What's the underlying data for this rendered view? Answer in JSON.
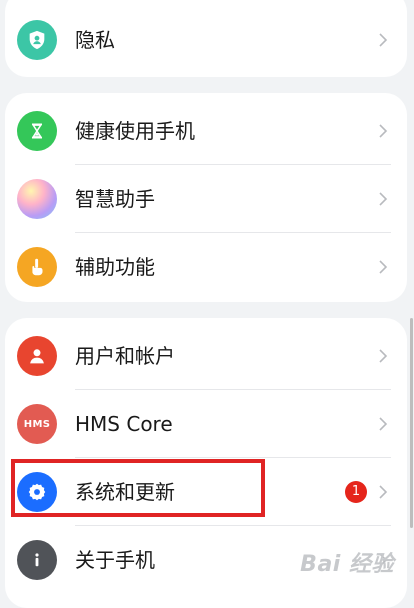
{
  "cards": [
    {
      "items": [
        {
          "label": "隐私",
          "icon": "privacy-shield-icon"
        }
      ]
    },
    {
      "items": [
        {
          "label": "健康使用手机",
          "icon": "hourglass-icon"
        },
        {
          "label": "智慧助手",
          "icon": "assistant-orb-icon"
        },
        {
          "label": "辅助功能",
          "icon": "hand-pointer-icon"
        }
      ]
    },
    {
      "items": [
        {
          "label": "用户和帐户",
          "icon": "user-icon"
        },
        {
          "label": "HMS Core",
          "icon": "hms-icon",
          "icon_text": "HMS"
        },
        {
          "label": "系统和更新",
          "icon": "gear-icon",
          "badge": "1"
        },
        {
          "label": "关于手机",
          "icon": "info-icon"
        }
      ]
    }
  ],
  "watermark": "Bai 经验",
  "colors": {
    "privacy": "#3cc6a6",
    "health": "#34c759",
    "accessibility": "#f5a623",
    "users": "#e8452f",
    "hms": "#e25b52",
    "system": "#1b6dff",
    "about": "#505358",
    "badge": "#e5251b",
    "highlight": "#e02424"
  }
}
